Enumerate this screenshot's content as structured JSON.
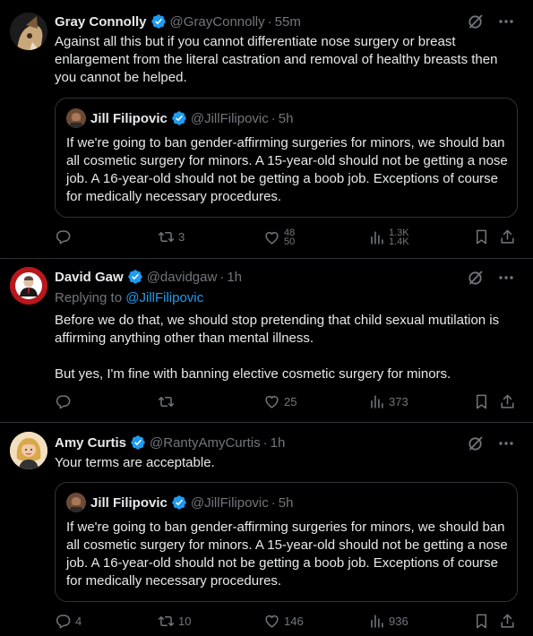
{
  "tweets": [
    {
      "name": "Gray Connolly",
      "handle": "@GrayConnolly",
      "time": "55m",
      "text": "Against all this but if you cannot differentiate nose surgery or breast enlargement from the literal castration and removal of healthy breasts then you cannot be helped.",
      "quote": {
        "name": "Jill Filipovic",
        "handle": "@JillFilipovic",
        "time": "5h",
        "text": "If we're going to ban gender-affirming surgeries for minors, we should ban all cosmetic surgery for minors. A 15-year-old should not be getting a nose job. A 16-year-old should not be getting a boob job. Exceptions of course for medically necessary procedures."
      },
      "replies": "",
      "reposts": "3",
      "likes": "48",
      "likes_next": "50",
      "views": "1.3K",
      "views_next": "1.4K"
    },
    {
      "name": "David Gaw",
      "handle": "@davidgaw",
      "time": "1h",
      "replying_prefix": "Replying to",
      "replying_to": "@JillFilipovic",
      "text1": "Before we do that, we should stop pretending that child sexual mutilation is affirming anything other than mental illness.",
      "text2": "But yes, I'm fine with banning elective cosmetic surgery for minors.",
      "replies": "",
      "reposts": "",
      "likes": "25",
      "views": "373"
    },
    {
      "name": "Amy Curtis",
      "handle": "@RantyAmyCurtis",
      "time": "1h",
      "text": "Your terms are acceptable.",
      "quote": {
        "name": "Jill Filipovic",
        "handle": "@JillFilipovic",
        "time": "5h",
        "text": "If we're going to ban gender-affirming surgeries for minors, we should ban all cosmetic surgery for minors. A 15-year-old should not be getting a nose job. A 16-year-old should not be getting a boob job. Exceptions of course for medically necessary procedures."
      },
      "replies": "4",
      "reposts": "10",
      "likes": "146",
      "views": "936"
    }
  ],
  "dot_separator": "·",
  "colors": {
    "background": "#000000",
    "text": "#e7e9ea",
    "muted": "#71767b",
    "accent": "#1d9bf0",
    "border": "#2f3336"
  },
  "icons": [
    "verified-badge-icon",
    "grok-icon",
    "more-icon",
    "reply-icon",
    "repost-icon",
    "like-icon",
    "views-icon",
    "bookmark-icon",
    "share-icon"
  ]
}
